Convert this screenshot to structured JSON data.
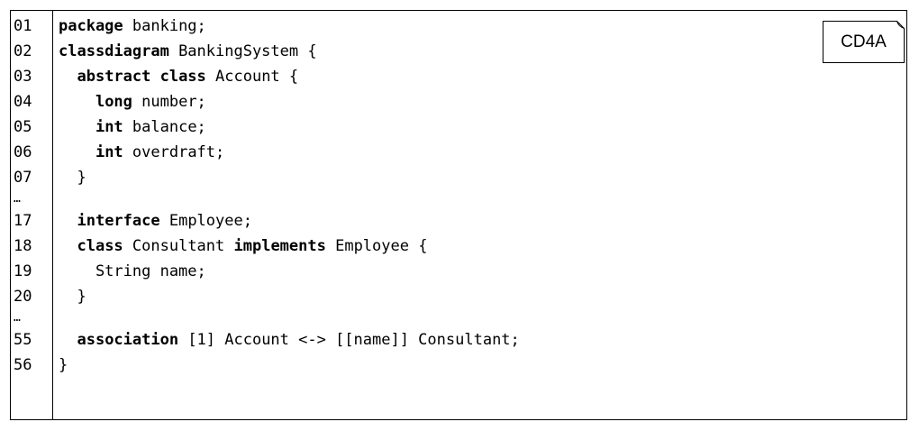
{
  "tag": "CD4A",
  "lines": [
    {
      "no": "01",
      "tokens": [
        {
          "t": "package",
          "kw": true
        },
        {
          "t": " banking;"
        }
      ]
    },
    {
      "no": "02",
      "tokens": [
        {
          "t": "classdiagram",
          "kw": true
        },
        {
          "t": " BankingSystem {"
        }
      ]
    },
    {
      "no": "03",
      "tokens": [
        {
          "t": "  "
        },
        {
          "t": "abstract class",
          "kw": true
        },
        {
          "t": " Account {"
        }
      ]
    },
    {
      "no": "04",
      "tokens": [
        {
          "t": "    "
        },
        {
          "t": "long",
          "kw": true
        },
        {
          "t": " number;"
        }
      ]
    },
    {
      "no": "05",
      "tokens": [
        {
          "t": "    "
        },
        {
          "t": "int",
          "kw": true
        },
        {
          "t": " balance;"
        }
      ]
    },
    {
      "no": "06",
      "tokens": [
        {
          "t": "    "
        },
        {
          "t": "int",
          "kw": true
        },
        {
          "t": " overdraft;"
        }
      ]
    },
    {
      "no": "07",
      "tokens": [
        {
          "t": "  }"
        }
      ]
    },
    {
      "no": "…",
      "ellipsis": true,
      "tokens": []
    },
    {
      "no": "17",
      "tokens": [
        {
          "t": "  "
        },
        {
          "t": "interface",
          "kw": true
        },
        {
          "t": " Employee;"
        }
      ]
    },
    {
      "no": "18",
      "tokens": [
        {
          "t": "  "
        },
        {
          "t": "class",
          "kw": true
        },
        {
          "t": " Consultant "
        },
        {
          "t": "implements",
          "kw": true
        },
        {
          "t": " Employee {"
        }
      ]
    },
    {
      "no": "19",
      "tokens": [
        {
          "t": "    String name;"
        }
      ]
    },
    {
      "no": "20",
      "tokens": [
        {
          "t": "  }"
        }
      ]
    },
    {
      "no": "…",
      "ellipsis": true,
      "tokens": []
    },
    {
      "no": "55",
      "tokens": [
        {
          "t": "  "
        },
        {
          "t": "association",
          "kw": true
        },
        {
          "t": " [1] Account <-> [[name]] Consultant;"
        }
      ]
    },
    {
      "no": "56",
      "tokens": [
        {
          "t": "}"
        }
      ]
    }
  ]
}
